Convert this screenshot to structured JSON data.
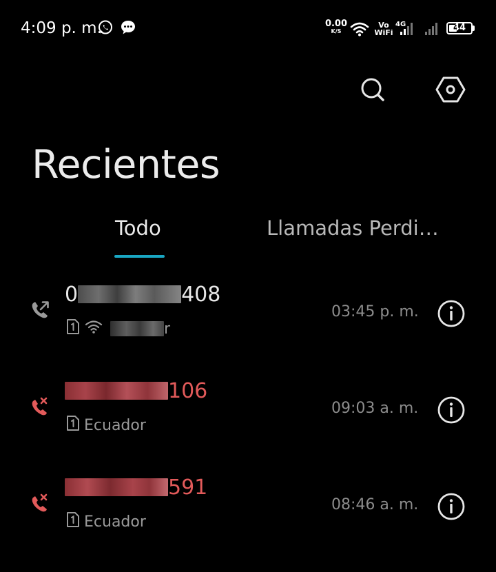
{
  "status_bar": {
    "time": "4:09 p. m.",
    "net_speed_value": "0.00",
    "net_speed_unit": "K/S",
    "vo": "Vo",
    "wifi": "WiFi",
    "network": "4G",
    "battery": "44",
    "battery_level": 0.44
  },
  "header": {
    "title": "Recientes"
  },
  "tabs": [
    {
      "label": "Todo",
      "active": true
    },
    {
      "label": "Llamadas Perdidas",
      "active": false
    }
  ],
  "calls": [
    {
      "type": "outgoing",
      "number_prefix": "0",
      "number_suffix": "408",
      "sub_label": "r",
      "via_wifi": true,
      "time": "03:45 p. m."
    },
    {
      "type": "missed",
      "number_prefix": "",
      "number_suffix": "106",
      "sub_label": "Ecuador",
      "via_wifi": false,
      "time": "09:03 a. m."
    },
    {
      "type": "missed",
      "number_prefix": "",
      "number_suffix": "591",
      "sub_label": "Ecuador",
      "via_wifi": false,
      "time": "08:46 a. m."
    }
  ],
  "colors": {
    "background": "#000000",
    "accent": "#19a6c2",
    "missed": "#e25a5a",
    "secondary_text": "#9a9a9a"
  }
}
